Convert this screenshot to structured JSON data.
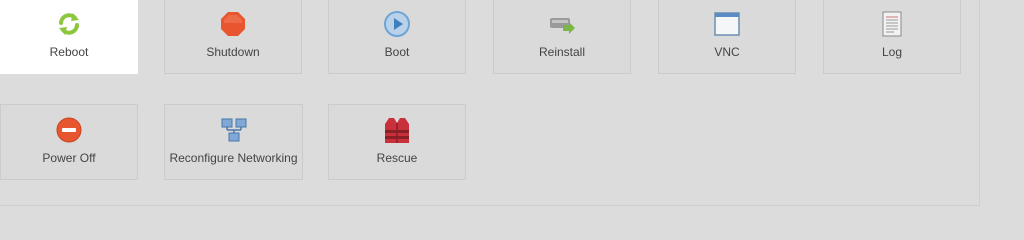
{
  "actions": {
    "reboot": {
      "label": "Reboot",
      "icon": "refresh-arrows-icon",
      "active": true
    },
    "shutdown": {
      "label": "Shutdown",
      "icon": "stop-octagon-icon"
    },
    "boot": {
      "label": "Boot",
      "icon": "play-circle-icon"
    },
    "reinstall": {
      "label": "Reinstall",
      "icon": "server-drive-icon"
    },
    "vnc": {
      "label": "VNC",
      "icon": "window-console-icon"
    },
    "log": {
      "label": "Log",
      "icon": "document-log-icon"
    },
    "poweroff": {
      "label": "Power Off",
      "icon": "power-minus-icon"
    },
    "reconfig": {
      "label": "Reconfigure Networking",
      "icon": "network-computers-icon"
    },
    "rescue": {
      "label": "Rescue",
      "icon": "life-vest-icon"
    }
  },
  "colors": {
    "background": "#dcdcdc",
    "active_tile": "#ffffff",
    "reboot_green": "#8dc63f",
    "shutdown_red": "#e8562f",
    "boot_blue": "#6ea4d6",
    "rescue_red": "#c8313b"
  }
}
